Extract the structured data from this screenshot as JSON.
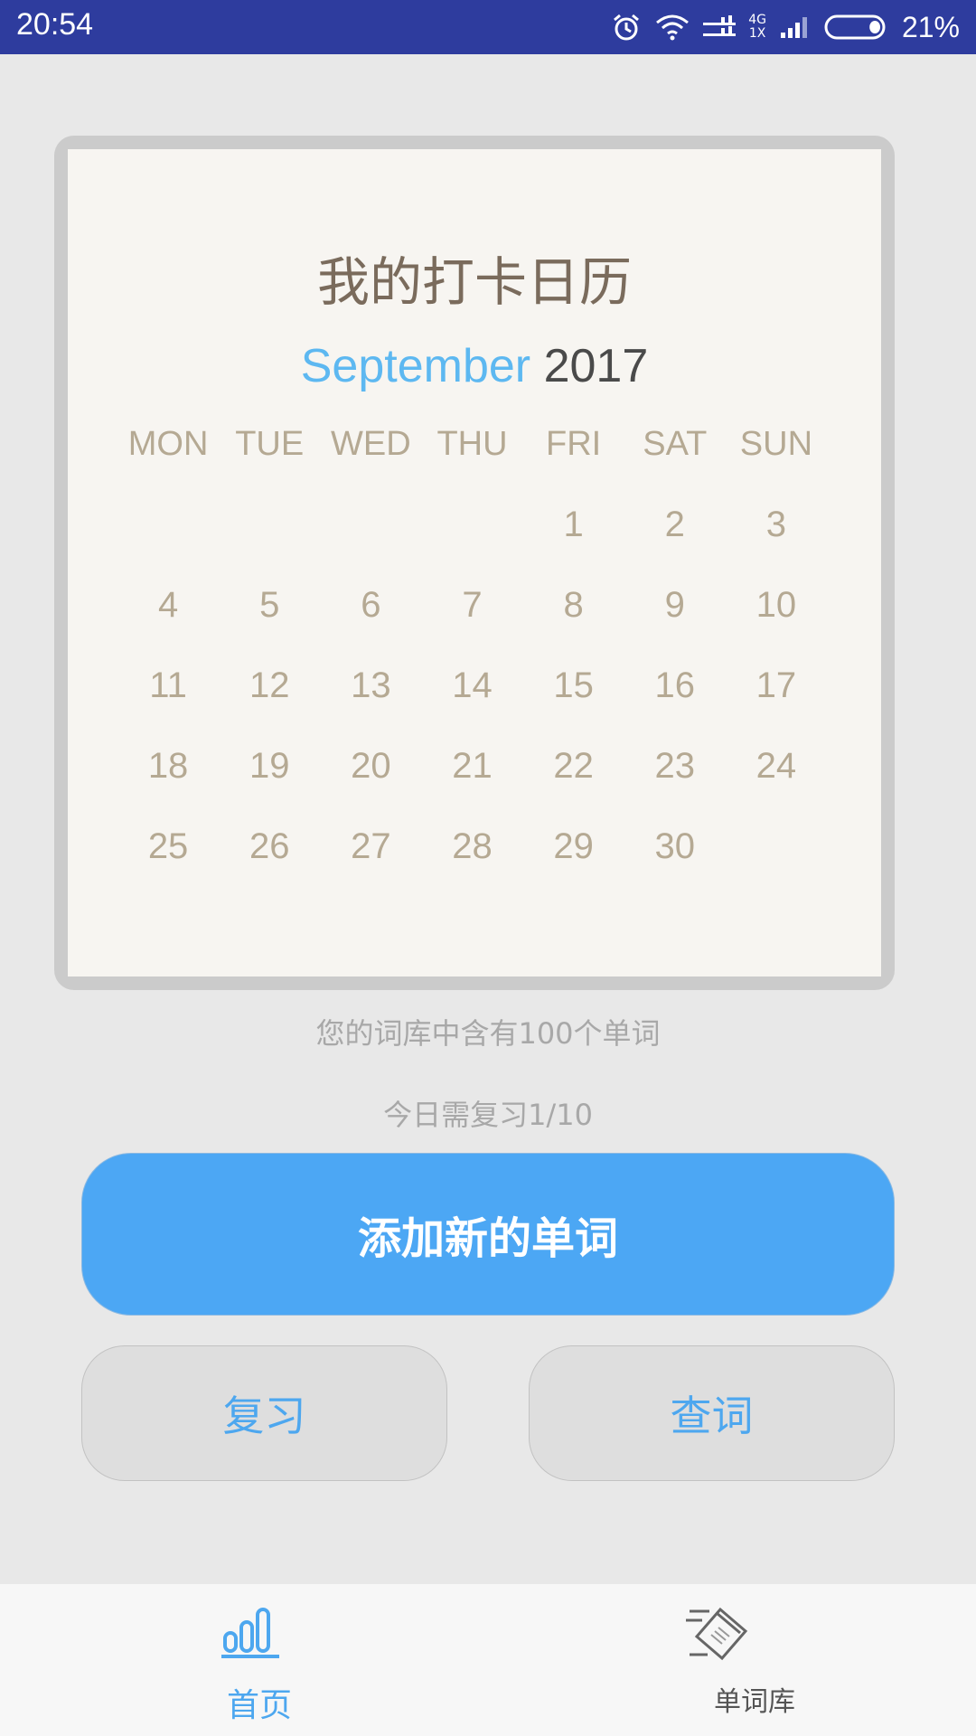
{
  "status_bar": {
    "time": "20:54",
    "network_top": "4G",
    "network_bottom": "1X",
    "battery_percent": "21%",
    "battery_level": 0.21,
    "icons": [
      "alarm-icon",
      "wifi-icon",
      "cellular-signal-icon",
      "cellular-signal-icon",
      "battery-icon"
    ]
  },
  "calendar": {
    "title": "我的打卡日历",
    "month": "September",
    "year": "2017",
    "weekdays": [
      "MON",
      "TUE",
      "WED",
      "THU",
      "FRI",
      "SAT",
      "SUN"
    ],
    "weeks": [
      [
        "",
        "",
        "",
        "",
        "1",
        "2",
        "3"
      ],
      [
        "4",
        "5",
        "6",
        "7",
        "8",
        "9",
        "10"
      ],
      [
        "11",
        "12",
        "13",
        "14",
        "15",
        "16",
        "17"
      ],
      [
        "18",
        "19",
        "20",
        "21",
        "22",
        "23",
        "24"
      ],
      [
        "25",
        "26",
        "27",
        "28",
        "29",
        "30",
        ""
      ]
    ]
  },
  "stats": {
    "word_count_text": "您的词库中含有100个单词",
    "review_text": "今日需复习1/10"
  },
  "buttons": {
    "add_word": "添加新的单词",
    "review": "复习",
    "lookup": "查词"
  },
  "bottom_nav": {
    "items": [
      {
        "label": "首页",
        "icon": "bar-chart-icon",
        "active": true
      },
      {
        "label": "单词库",
        "icon": "word-cards-icon",
        "active": false
      }
    ]
  },
  "colors": {
    "status_bar": "#2e3c9e",
    "accent": "#4da7ef",
    "primary_button": "#4ca7f4",
    "calendar_text": "#b5a993",
    "month": "#5db8f1"
  }
}
